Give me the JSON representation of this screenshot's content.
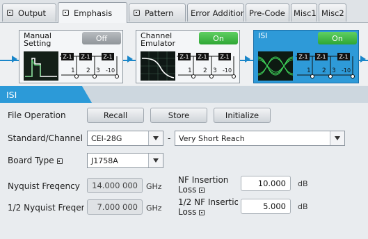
{
  "tabs": [
    {
      "label": "Output",
      "active": false
    },
    {
      "label": "Emphasis",
      "active": true
    },
    {
      "label": "Pattern",
      "active": false
    },
    {
      "label": "Error Addition",
      "active": false
    },
    {
      "label": "Pre-Code",
      "active": false
    },
    {
      "label": "Misc1",
      "active": false
    },
    {
      "label": "Misc2",
      "active": false
    }
  ],
  "blocks": {
    "manual": {
      "title_line1": "Manual",
      "title_line2": "Setting",
      "state": "Off",
      "icon": "pulse-waveform-icon"
    },
    "emulator": {
      "title_line1": "Channel",
      "title_line2": "Emulator",
      "state": "On",
      "icon": "frequency-response-icon"
    },
    "isi": {
      "title_line1": "ISI",
      "state": "On",
      "icon": "eye-diagram-icon"
    },
    "taps": {
      "z1": "Z-1",
      "z2": "Z-1",
      "z3": "Z-1",
      "n1": "1",
      "n2": "2",
      "n3": "3",
      "n10": "-10"
    }
  },
  "panel": {
    "title": "ISI",
    "file_operation": {
      "label": "File Operation",
      "recall": "Recall",
      "store": "Store",
      "initialize": "Initialize"
    },
    "standard": {
      "label": "Standard/Channel",
      "value": "CEI-28G",
      "separator": "-",
      "reach": "Very Short Reach"
    },
    "board": {
      "label": "Board Type",
      "value": "J1758A"
    },
    "nyquist": {
      "label": "Nyquist Freqency",
      "value": "14.000 000",
      "unit": "GHz"
    },
    "half_nyquist": {
      "label": "1/2 Nyquist Freqency",
      "value": "7.000 000",
      "unit": "GHz"
    },
    "nf_loss": {
      "label_line1": "NF Insertion",
      "label_line2": "Loss",
      "value": "10.000",
      "unit": "dB"
    },
    "half_nf_loss": {
      "label_line1": "1/2 NF Insertion",
      "label_line2": "Loss",
      "value": "5.000",
      "unit": "dB"
    }
  },
  "colors": {
    "accent": "#2c9ad8",
    "on": "#2ea634",
    "off": "#8f9499",
    "flow": "#1a86c9"
  }
}
